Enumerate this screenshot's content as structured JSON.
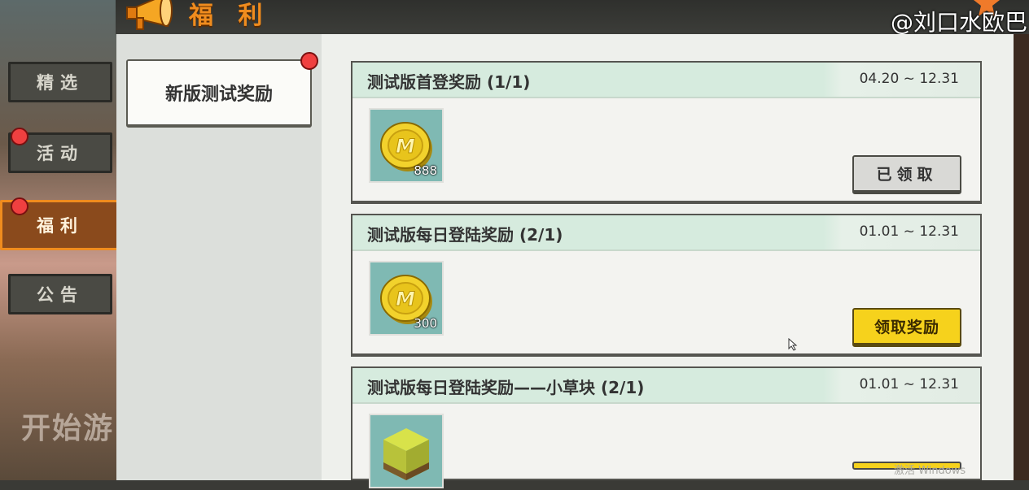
{
  "header": {
    "title": "福 利"
  },
  "watermark": "@刘口水欧巴",
  "background": {
    "start_text": "开始游"
  },
  "sidebar": {
    "items": [
      {
        "label": "精选",
        "active": false,
        "badge": false
      },
      {
        "label": "活动",
        "active": false,
        "badge": true
      },
      {
        "label": "福利",
        "active": true,
        "badge": true
      },
      {
        "label": "公告",
        "active": false,
        "badge": false
      }
    ]
  },
  "sub_tabs": [
    {
      "label": "新版测试奖励",
      "badge": true
    }
  ],
  "rewards": [
    {
      "title": "测试版首登奖励 (1/1)",
      "date": "04.20 ~ 12.31",
      "item_icon": "coin-icon",
      "count": "888",
      "button": "已领取",
      "button_state": "claimed"
    },
    {
      "title": "测试版每日登陆奖励 (2/1)",
      "date": "01.01 ~ 12.31",
      "item_icon": "coin-icon",
      "count": "300",
      "button": "领取奖励",
      "button_state": "available"
    },
    {
      "title": "测试版每日登陆奖励——小草块 (2/1)",
      "date": "01.01 ~ 12.31",
      "item_icon": "grass-block-icon",
      "count": "",
      "button": "",
      "button_state": "available"
    }
  ],
  "system": {
    "activation_text": "激活 Windows"
  },
  "colors": {
    "accent": "#f08c1e",
    "claim_yellow": "#f6d21c",
    "badge_red": "#f04040",
    "card_header": "#d6ebde"
  }
}
